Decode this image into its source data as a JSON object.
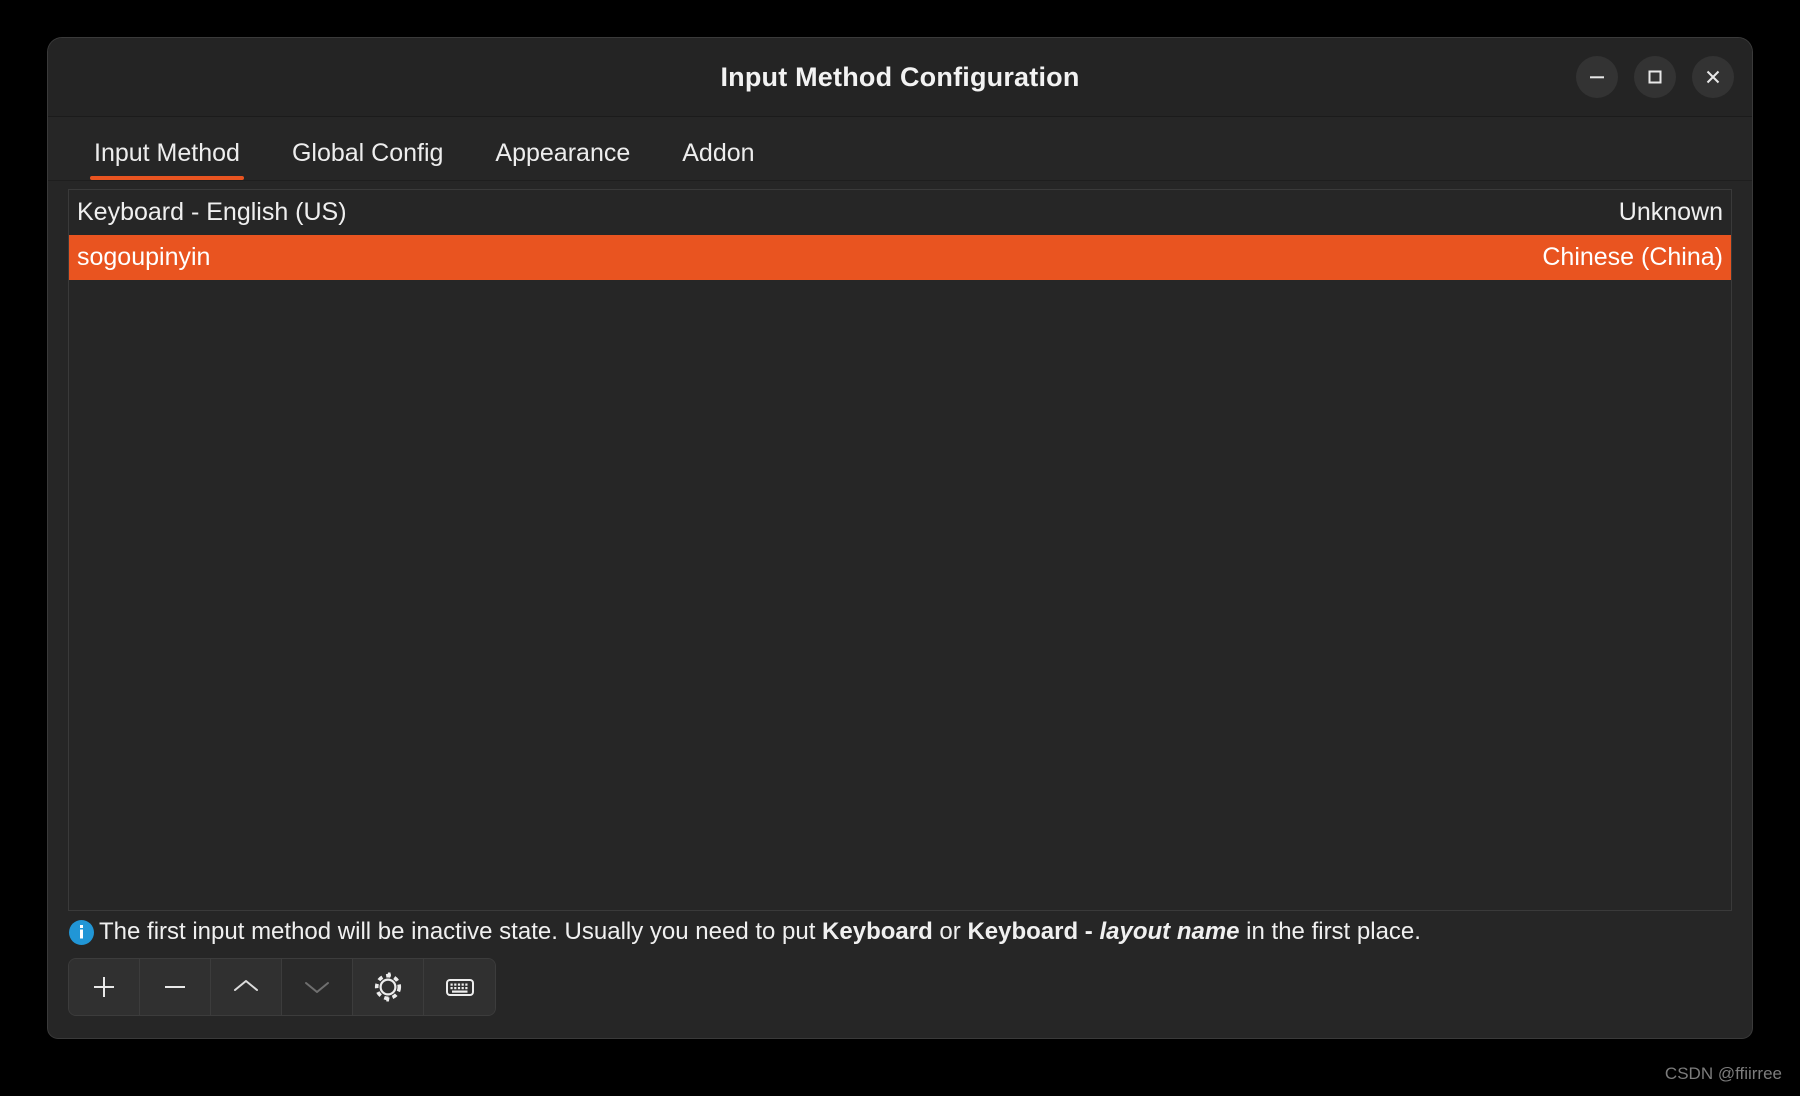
{
  "window": {
    "title": "Input Method Configuration",
    "controls": [
      {
        "name": "minimize",
        "icon": "minimize-icon"
      },
      {
        "name": "maximize",
        "icon": "maximize-icon"
      },
      {
        "name": "close",
        "icon": "close-icon"
      }
    ]
  },
  "tabs": [
    {
      "label": "Input Method",
      "active": true
    },
    {
      "label": "Global Config",
      "active": false
    },
    {
      "label": "Appearance",
      "active": false
    },
    {
      "label": "Addon",
      "active": false
    }
  ],
  "list": {
    "rows": [
      {
        "name": "Keyboard - English (US)",
        "language": "Unknown",
        "selected": false
      },
      {
        "name": "sogoupinyin",
        "language": "Chinese (China)",
        "selected": true
      }
    ]
  },
  "info": {
    "icon": "info-icon",
    "part1": "The first input method will be inactive state. Usually you need to put ",
    "bold1": "Keyboard",
    "part2": " or ",
    "bold2": "Keyboard - ",
    "italic1": "layout name",
    "part3": " in the first place."
  },
  "toolbar": {
    "buttons": [
      {
        "label": "add-input-method",
        "icon": "plus-icon",
        "disabled": false
      },
      {
        "label": "remove-input-method",
        "icon": "minus-icon",
        "disabled": false
      },
      {
        "label": "move-up",
        "icon": "chevron-up-icon",
        "disabled": false
      },
      {
        "label": "move-down",
        "icon": "chevron-down-icon",
        "disabled": true
      },
      {
        "label": "configure",
        "icon": "gear-icon",
        "disabled": false
      },
      {
        "label": "keyboard-layout",
        "icon": "keyboard-icon",
        "disabled": false
      }
    ]
  },
  "watermark": "CSDN @ffiirree",
  "colors": {
    "accent": "#e95420",
    "window_bg": "#262626",
    "titlebar_bg": "#242424",
    "info_blue": "#2196d6",
    "text": "#efefef"
  }
}
